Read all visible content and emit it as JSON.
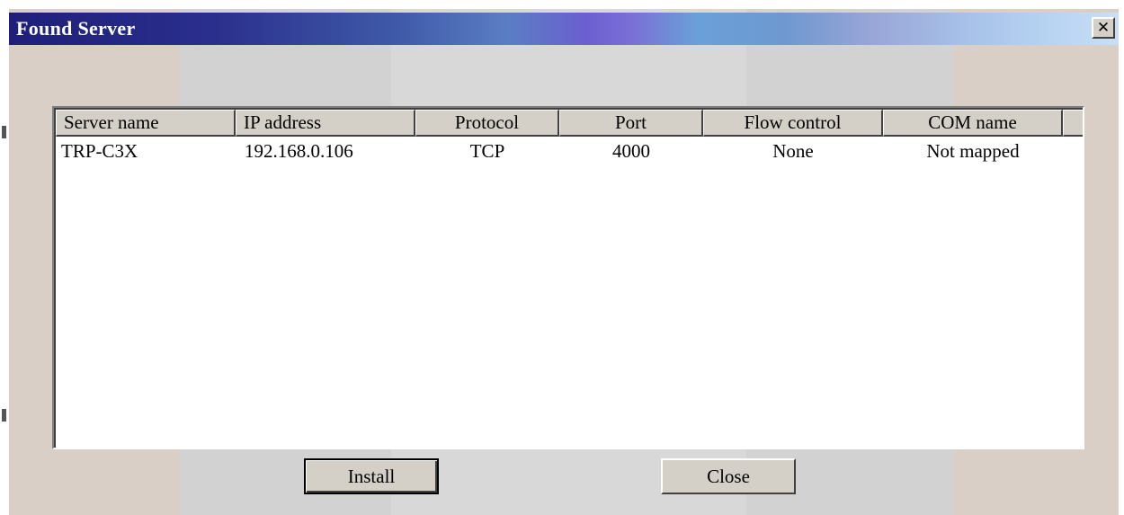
{
  "window": {
    "title": "Found Server",
    "close_glyph": "✕"
  },
  "table": {
    "columns": [
      {
        "label": "Server name"
      },
      {
        "label": "IP address"
      },
      {
        "label": "Protocol"
      },
      {
        "label": "Port"
      },
      {
        "label": "Flow control"
      },
      {
        "label": "COM name"
      }
    ],
    "rows": [
      [
        "TRP-C3X",
        "192.168.0.106",
        "TCP",
        "4000",
        "None",
        "Not mapped"
      ]
    ]
  },
  "buttons": {
    "install_label": "Install",
    "close_label": "Close"
  },
  "colors": {
    "title_text": "#ffffff",
    "dialog_face": "#d4d0c8",
    "list_background": "#ffffff"
  }
}
